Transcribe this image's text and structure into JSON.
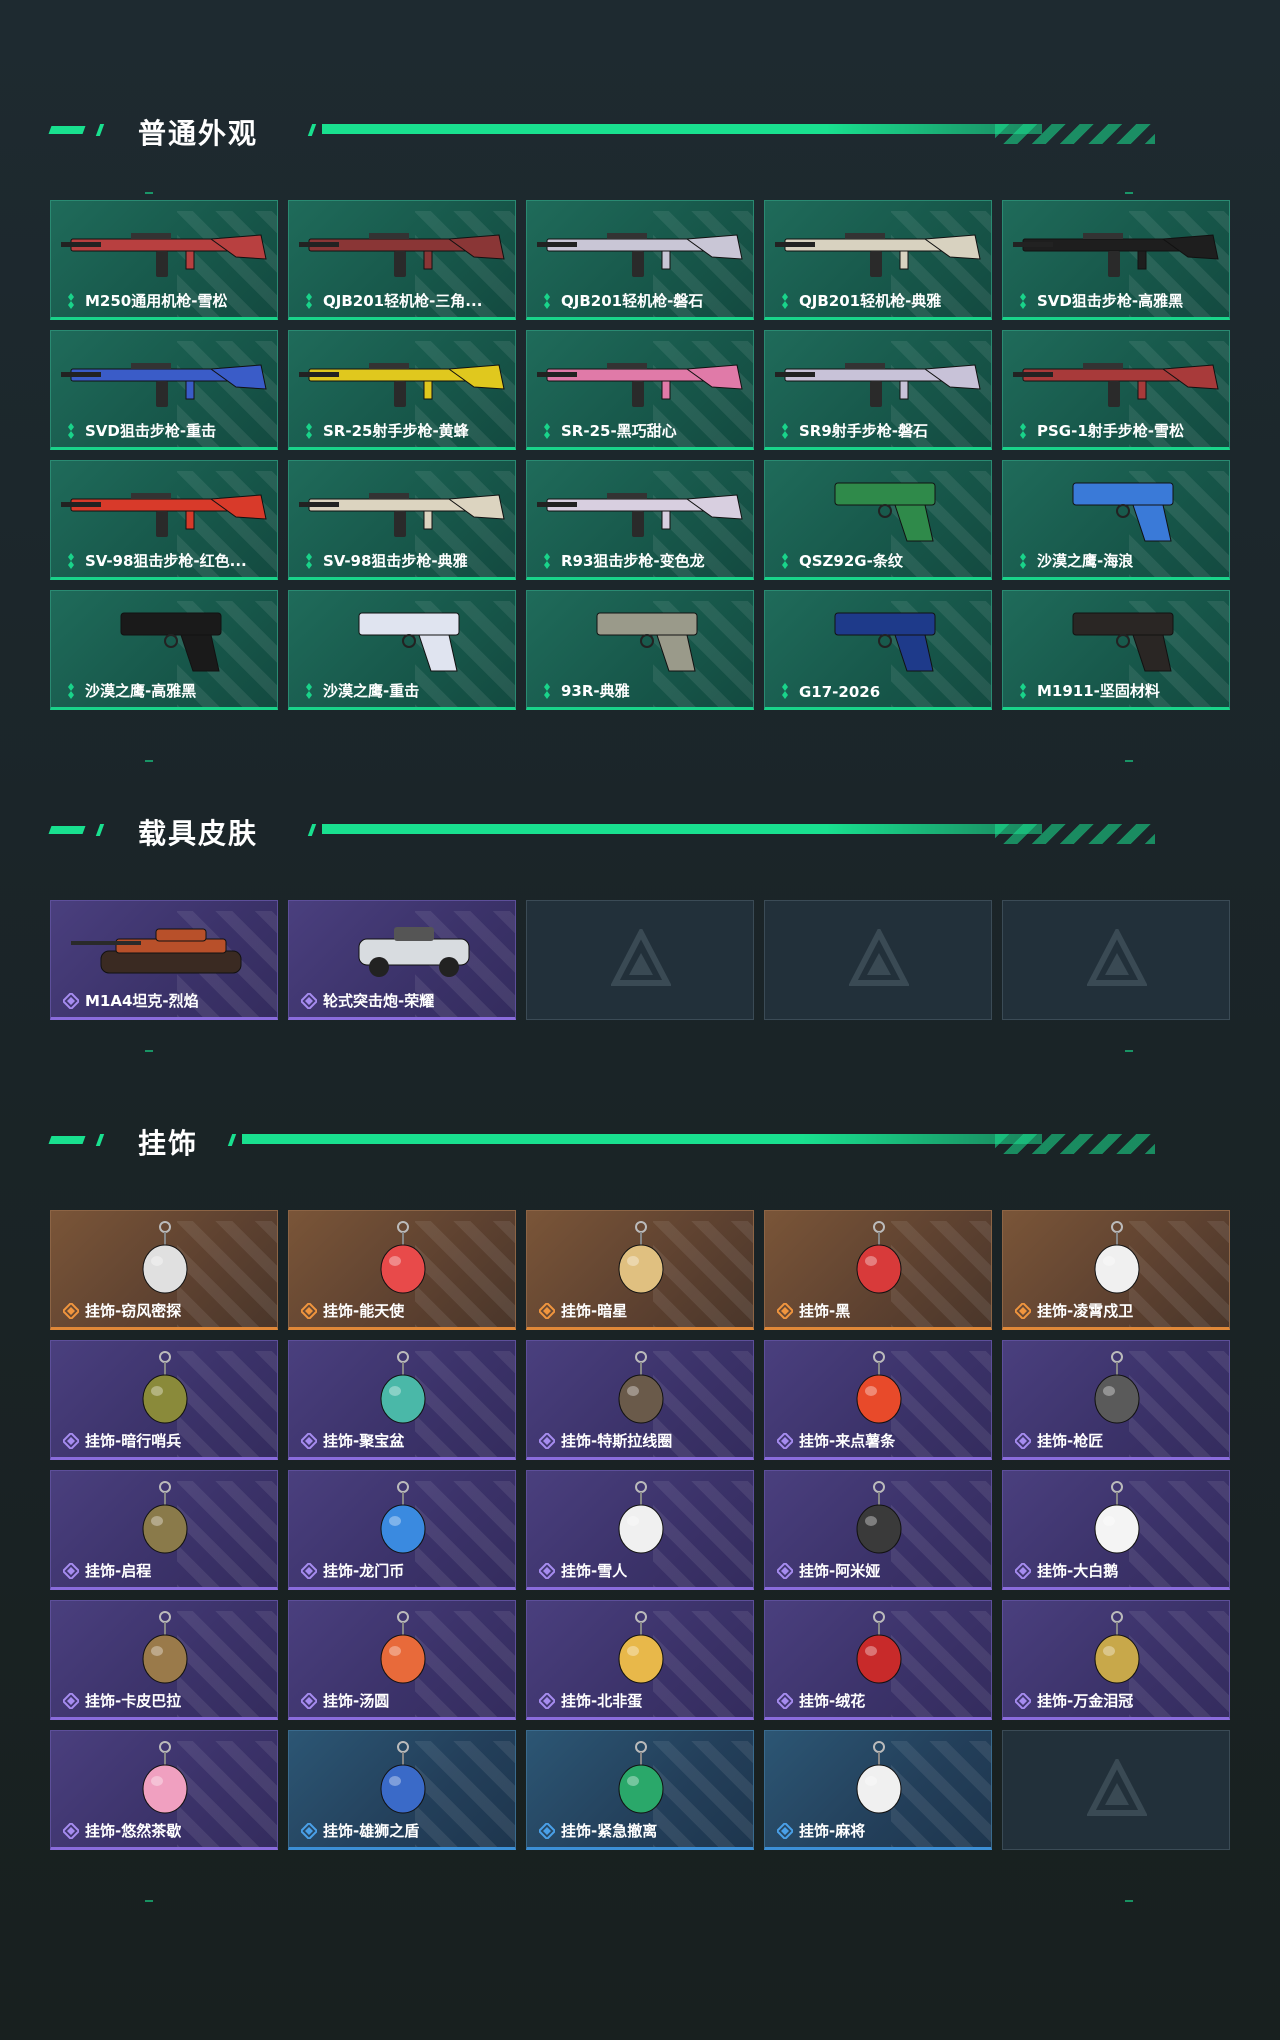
{
  "sections": {
    "normal": {
      "title": "普通外观"
    },
    "vehicle": {
      "title": "载具皮肤"
    },
    "pendant": {
      "title": "挂饰"
    }
  },
  "colors": {
    "accent": "#19e08f",
    "green_rarity": "#19d48a",
    "purple_rarity": "#8a6cdc",
    "orange_rarity": "#e08838",
    "blue_rarity": "#3c8fd6"
  },
  "weapons": [
    {
      "label": "M250通用机枪-雪松",
      "rarity": "green",
      "kind": "rifle",
      "tint": "#b84040"
    },
    {
      "label": "QJB201轻机枪-三角...",
      "rarity": "green",
      "kind": "rifle",
      "tint": "#8a3636"
    },
    {
      "label": "QJB201轻机枪-磐石",
      "rarity": "green",
      "kind": "rifle",
      "tint": "#c9c6d6"
    },
    {
      "label": "QJB201轻机枪-典雅",
      "rarity": "green",
      "kind": "rifle",
      "tint": "#d8d2c0"
    },
    {
      "label": "SVD狙击步枪-高雅黑",
      "rarity": "green",
      "kind": "rifle",
      "tint": "#1e1e1e"
    },
    {
      "label": "SVD狙击步枪-重击",
      "rarity": "green",
      "kind": "rifle",
      "tint": "#3a5cc8"
    },
    {
      "label": "SR-25射手步枪-黄蜂",
      "rarity": "green",
      "kind": "rifle",
      "tint": "#e0c81e"
    },
    {
      "label": "SR-25-黑巧甜心",
      "rarity": "green",
      "kind": "rifle",
      "tint": "#e07aa8"
    },
    {
      "label": "SR9射手步枪-磐石",
      "rarity": "green",
      "kind": "rifle",
      "tint": "#c8c2d8"
    },
    {
      "label": "PSG-1射手步枪-雪松",
      "rarity": "green",
      "kind": "rifle",
      "tint": "#a83a3a"
    },
    {
      "label": "SV-98狙击步枪-红色...",
      "rarity": "green",
      "kind": "rifle",
      "tint": "#d83a2a"
    },
    {
      "label": "SV-98狙击步枪-典雅",
      "rarity": "green",
      "kind": "rifle",
      "tint": "#dcd4c0"
    },
    {
      "label": "R93狙击步枪-变色龙",
      "rarity": "green",
      "kind": "rifle",
      "tint": "#d8cfe0"
    },
    {
      "label": "QSZ92G-条纹",
      "rarity": "green",
      "kind": "pistol",
      "tint": "#2f8a4a"
    },
    {
      "label": "沙漠之鹰-海浪",
      "rarity": "green",
      "kind": "pistol",
      "tint": "#3a7ad8"
    },
    {
      "label": "沙漠之鹰-高雅黑",
      "rarity": "green",
      "kind": "pistol",
      "tint": "#1a1a1a"
    },
    {
      "label": "沙漠之鹰-重击",
      "rarity": "green",
      "kind": "pistol",
      "tint": "#e0e4f0"
    },
    {
      "label": "93R-典雅",
      "rarity": "green",
      "kind": "pistol",
      "tint": "#9a9a8a"
    },
    {
      "label": "G17-2026",
      "rarity": "green",
      "kind": "pistol",
      "tint": "#1e3a8a"
    },
    {
      "label": "M1911-坚固材料",
      "rarity": "green",
      "kind": "pistol",
      "tint": "#2a2624"
    }
  ],
  "vehicles": [
    {
      "label": "M1A4坦克-烈焰",
      "rarity": "purple",
      "kind": "tank",
      "tint": "#b8502a"
    },
    {
      "label": "轮式突击炮-荣耀",
      "rarity": "purple",
      "kind": "car",
      "tint": "#d8dce0"
    },
    {
      "label": "",
      "rarity": "empty",
      "kind": "empty",
      "tint": ""
    },
    {
      "label": "",
      "rarity": "empty",
      "kind": "empty",
      "tint": ""
    },
    {
      "label": "",
      "rarity": "empty",
      "kind": "empty",
      "tint": ""
    }
  ],
  "pendants": [
    {
      "label": "挂饰-窃风密探",
      "rarity": "orange",
      "kind": "charm",
      "tint": "#e0e0e0"
    },
    {
      "label": "挂饰-能天使",
      "rarity": "orange",
      "kind": "charm",
      "tint": "#e84a4a"
    },
    {
      "label": "挂饰-暗星",
      "rarity": "orange",
      "kind": "charm",
      "tint": "#e0c080"
    },
    {
      "label": "挂饰-黑",
      "rarity": "orange",
      "kind": "charm",
      "tint": "#d83a3a"
    },
    {
      "label": "挂饰-凌霄戍卫",
      "rarity": "orange",
      "kind": "charm",
      "tint": "#f0f0f0"
    },
    {
      "label": "挂饰-暗行哨兵",
      "rarity": "purple",
      "kind": "charm",
      "tint": "#8a8a3a"
    },
    {
      "label": "挂饰-聚宝盆",
      "rarity": "purple",
      "kind": "charm",
      "tint": "#4ab8a8"
    },
    {
      "label": "挂饰-特斯拉线圈",
      "rarity": "purple",
      "kind": "charm",
      "tint": "#6a5a4a"
    },
    {
      "label": "挂饰-来点薯条",
      "rarity": "purple",
      "kind": "charm",
      "tint": "#e84a2a"
    },
    {
      "label": "挂饰-枪匠",
      "rarity": "purple",
      "kind": "charm",
      "tint": "#5a5a5a"
    },
    {
      "label": "挂饰-启程",
      "rarity": "purple",
      "kind": "charm",
      "tint": "#8a7a4a"
    },
    {
      "label": "挂饰-龙门币",
      "rarity": "purple",
      "kind": "charm",
      "tint": "#3a8ae0"
    },
    {
      "label": "挂饰-雪人",
      "rarity": "purple",
      "kind": "charm",
      "tint": "#f0f0f0"
    },
    {
      "label": "挂饰-阿米娅",
      "rarity": "purple",
      "kind": "charm",
      "tint": "#3a3a3a"
    },
    {
      "label": "挂饰-大白鹅",
      "rarity": "purple",
      "kind": "charm",
      "tint": "#f4f4f4"
    },
    {
      "label": "挂饰-卡皮巴拉",
      "rarity": "purple",
      "kind": "charm",
      "tint": "#9a7a4a"
    },
    {
      "label": "挂饰-汤圆",
      "rarity": "purple",
      "kind": "charm",
      "tint": "#e86a3a"
    },
    {
      "label": "挂饰-北非蛋",
      "rarity": "purple",
      "kind": "charm",
      "tint": "#e8b84a"
    },
    {
      "label": "挂饰-绒花",
      "rarity": "purple",
      "kind": "charm",
      "tint": "#c82a2a"
    },
    {
      "label": "挂饰-万金泪冠",
      "rarity": "purple",
      "kind": "charm",
      "tint": "#c8a84a"
    },
    {
      "label": "挂饰-悠然茶歇",
      "rarity": "purple",
      "kind": "charm",
      "tint": "#f0a0c0"
    },
    {
      "label": "挂饰-雄狮之盾",
      "rarity": "blue",
      "kind": "charm",
      "tint": "#3a6ac8"
    },
    {
      "label": "挂饰-紧急撤离",
      "rarity": "blue",
      "kind": "charm",
      "tint": "#2aa86a"
    },
    {
      "label": "挂饰-麻将",
      "rarity": "blue",
      "kind": "charm",
      "tint": "#f0f0f0"
    },
    {
      "label": "",
      "rarity": "empty",
      "kind": "empty",
      "tint": ""
    }
  ]
}
